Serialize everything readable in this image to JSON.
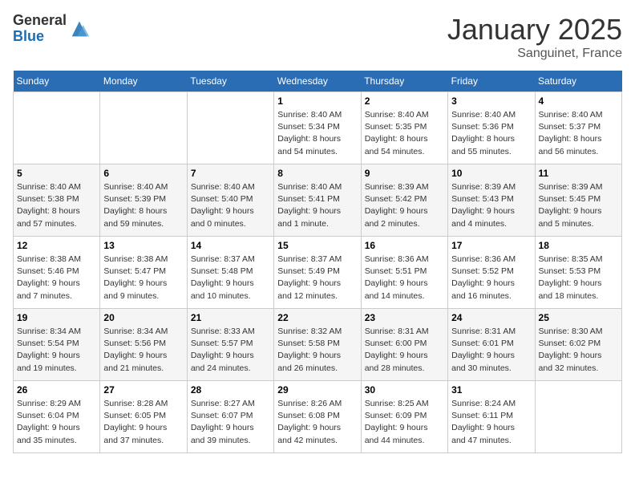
{
  "logo": {
    "general": "General",
    "blue": "Blue"
  },
  "title": "January 2025",
  "location": "Sanguinet, France",
  "days_of_week": [
    "Sunday",
    "Monday",
    "Tuesday",
    "Wednesday",
    "Thursday",
    "Friday",
    "Saturday"
  ],
  "weeks": [
    [
      {
        "day": "",
        "info": ""
      },
      {
        "day": "",
        "info": ""
      },
      {
        "day": "",
        "info": ""
      },
      {
        "day": "1",
        "info": "Sunrise: 8:40 AM\nSunset: 5:34 PM\nDaylight: 8 hours\nand 54 minutes."
      },
      {
        "day": "2",
        "info": "Sunrise: 8:40 AM\nSunset: 5:35 PM\nDaylight: 8 hours\nand 54 minutes."
      },
      {
        "day": "3",
        "info": "Sunrise: 8:40 AM\nSunset: 5:36 PM\nDaylight: 8 hours\nand 55 minutes."
      },
      {
        "day": "4",
        "info": "Sunrise: 8:40 AM\nSunset: 5:37 PM\nDaylight: 8 hours\nand 56 minutes."
      }
    ],
    [
      {
        "day": "5",
        "info": "Sunrise: 8:40 AM\nSunset: 5:38 PM\nDaylight: 8 hours\nand 57 minutes."
      },
      {
        "day": "6",
        "info": "Sunrise: 8:40 AM\nSunset: 5:39 PM\nDaylight: 8 hours\nand 59 minutes."
      },
      {
        "day": "7",
        "info": "Sunrise: 8:40 AM\nSunset: 5:40 PM\nDaylight: 9 hours\nand 0 minutes."
      },
      {
        "day": "8",
        "info": "Sunrise: 8:40 AM\nSunset: 5:41 PM\nDaylight: 9 hours\nand 1 minute."
      },
      {
        "day": "9",
        "info": "Sunrise: 8:39 AM\nSunset: 5:42 PM\nDaylight: 9 hours\nand 2 minutes."
      },
      {
        "day": "10",
        "info": "Sunrise: 8:39 AM\nSunset: 5:43 PM\nDaylight: 9 hours\nand 4 minutes."
      },
      {
        "day": "11",
        "info": "Sunrise: 8:39 AM\nSunset: 5:45 PM\nDaylight: 9 hours\nand 5 minutes."
      }
    ],
    [
      {
        "day": "12",
        "info": "Sunrise: 8:38 AM\nSunset: 5:46 PM\nDaylight: 9 hours\nand 7 minutes."
      },
      {
        "day": "13",
        "info": "Sunrise: 8:38 AM\nSunset: 5:47 PM\nDaylight: 9 hours\nand 9 minutes."
      },
      {
        "day": "14",
        "info": "Sunrise: 8:37 AM\nSunset: 5:48 PM\nDaylight: 9 hours\nand 10 minutes."
      },
      {
        "day": "15",
        "info": "Sunrise: 8:37 AM\nSunset: 5:49 PM\nDaylight: 9 hours\nand 12 minutes."
      },
      {
        "day": "16",
        "info": "Sunrise: 8:36 AM\nSunset: 5:51 PM\nDaylight: 9 hours\nand 14 minutes."
      },
      {
        "day": "17",
        "info": "Sunrise: 8:36 AM\nSunset: 5:52 PM\nDaylight: 9 hours\nand 16 minutes."
      },
      {
        "day": "18",
        "info": "Sunrise: 8:35 AM\nSunset: 5:53 PM\nDaylight: 9 hours\nand 18 minutes."
      }
    ],
    [
      {
        "day": "19",
        "info": "Sunrise: 8:34 AM\nSunset: 5:54 PM\nDaylight: 9 hours\nand 19 minutes."
      },
      {
        "day": "20",
        "info": "Sunrise: 8:34 AM\nSunset: 5:56 PM\nDaylight: 9 hours\nand 21 minutes."
      },
      {
        "day": "21",
        "info": "Sunrise: 8:33 AM\nSunset: 5:57 PM\nDaylight: 9 hours\nand 24 minutes."
      },
      {
        "day": "22",
        "info": "Sunrise: 8:32 AM\nSunset: 5:58 PM\nDaylight: 9 hours\nand 26 minutes."
      },
      {
        "day": "23",
        "info": "Sunrise: 8:31 AM\nSunset: 6:00 PM\nDaylight: 9 hours\nand 28 minutes."
      },
      {
        "day": "24",
        "info": "Sunrise: 8:31 AM\nSunset: 6:01 PM\nDaylight: 9 hours\nand 30 minutes."
      },
      {
        "day": "25",
        "info": "Sunrise: 8:30 AM\nSunset: 6:02 PM\nDaylight: 9 hours\nand 32 minutes."
      }
    ],
    [
      {
        "day": "26",
        "info": "Sunrise: 8:29 AM\nSunset: 6:04 PM\nDaylight: 9 hours\nand 35 minutes."
      },
      {
        "day": "27",
        "info": "Sunrise: 8:28 AM\nSunset: 6:05 PM\nDaylight: 9 hours\nand 37 minutes."
      },
      {
        "day": "28",
        "info": "Sunrise: 8:27 AM\nSunset: 6:07 PM\nDaylight: 9 hours\nand 39 minutes."
      },
      {
        "day": "29",
        "info": "Sunrise: 8:26 AM\nSunset: 6:08 PM\nDaylight: 9 hours\nand 42 minutes."
      },
      {
        "day": "30",
        "info": "Sunrise: 8:25 AM\nSunset: 6:09 PM\nDaylight: 9 hours\nand 44 minutes."
      },
      {
        "day": "31",
        "info": "Sunrise: 8:24 AM\nSunset: 6:11 PM\nDaylight: 9 hours\nand 47 minutes."
      },
      {
        "day": "",
        "info": ""
      }
    ]
  ]
}
